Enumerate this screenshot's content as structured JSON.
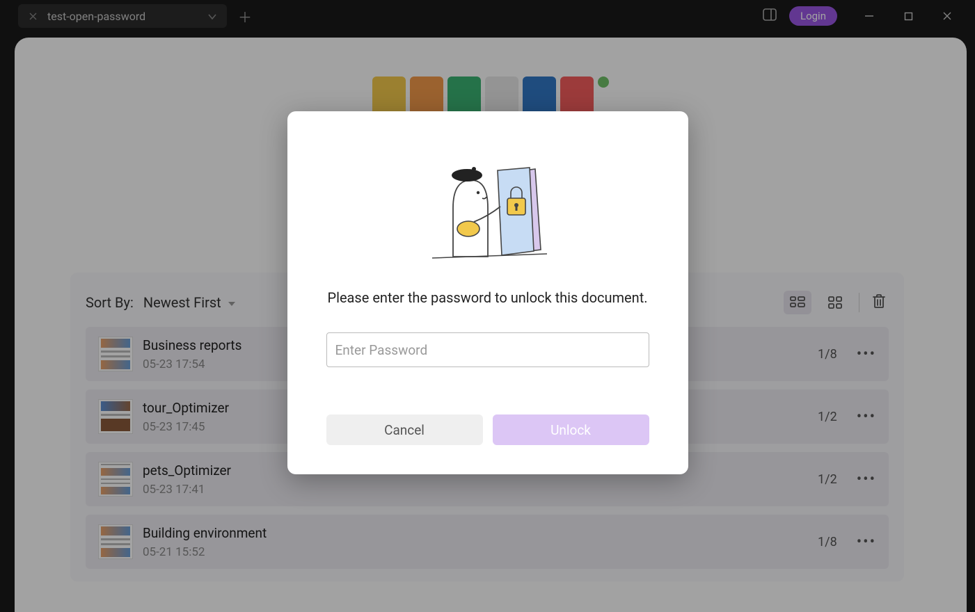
{
  "window": {
    "tab_title": "test-open-password",
    "login": "Login"
  },
  "docs": {
    "sort_label": "Sort By:",
    "sort_value": "Newest First",
    "items": [
      {
        "name": "Business reports",
        "date": "05-23 17:54",
        "pages": "1/8"
      },
      {
        "name": "tour_Optimizer",
        "date": "05-23 17:45",
        "pages": "1/2"
      },
      {
        "name": "pets_Optimizer",
        "date": "05-23 17:41",
        "pages": "1/2"
      },
      {
        "name": "Building environment",
        "date": "05-21 15:52",
        "pages": "1/8"
      }
    ]
  },
  "modal": {
    "message": "Please enter the password to unlock this document.",
    "placeholder": "Enter Password",
    "cancel": "Cancel",
    "unlock": "Unlock"
  },
  "colors": {
    "accent": "#9956e3"
  }
}
